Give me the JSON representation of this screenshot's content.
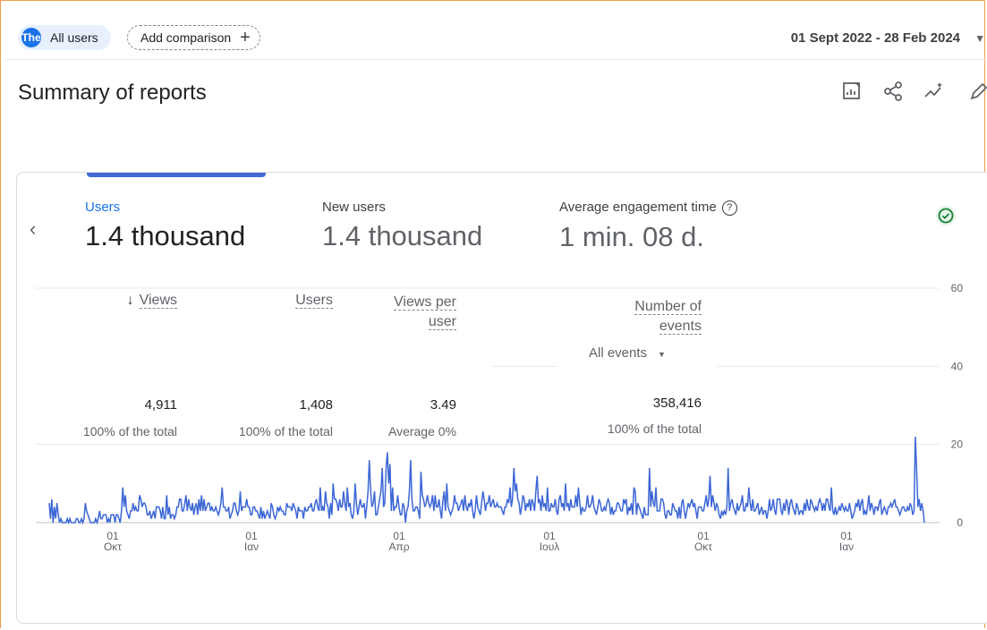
{
  "topbar": {
    "avatar": "The",
    "segment": "All users",
    "add_comparison": "Add comparison",
    "date_range": "01 Sept 2022 - 28 Feb 2024"
  },
  "page_title": "Summary of reports",
  "metrics": [
    {
      "label": "Users",
      "value": "1.4 thousand"
    },
    {
      "label": "New users",
      "value": "1.4 thousand"
    },
    {
      "label": "Average engagement time",
      "value": "1 min. 08 d."
    }
  ],
  "table": {
    "columns": [
      "Views",
      "Users",
      "Views per user",
      "Number of events"
    ],
    "values": [
      "4,911",
      "1,408",
      "3.49",
      "358,416"
    ],
    "subs": [
      "100% of the total",
      "100% of the total",
      "Average 0%",
      "100% of the total"
    ],
    "events_dropdown": "All events"
  },
  "chart_data": {
    "type": "line",
    "x_ticks": [
      {
        "day": "01",
        "month": "Οκτ"
      },
      {
        "day": "01",
        "month": "Ιαν"
      },
      {
        "day": "01",
        "month": "Απρ"
      },
      {
        "day": "01",
        "month": "Ιουλ"
      },
      {
        "day": "01",
        "month": "Οκτ"
      },
      {
        "day": "01",
        "month": "Ιαν"
      }
    ],
    "ylim": [
      0,
      60
    ],
    "y_ticks": [
      "60",
      "40",
      "20",
      "0"
    ],
    "series": [
      {
        "color": "#3c66d6",
        "values": [
          5,
          1,
          6,
          0,
          4,
          1,
          5,
          2,
          0,
          1,
          0,
          0,
          0,
          0,
          1,
          0,
          1,
          0,
          0,
          0,
          0,
          1,
          1,
          0,
          0,
          1,
          0,
          1,
          5,
          3,
          2,
          1,
          0,
          0,
          0,
          0,
          1,
          0,
          1,
          3,
          1,
          1,
          2,
          2,
          2,
          0,
          1,
          0,
          2,
          2,
          2,
          0,
          2,
          2,
          1,
          0,
          3,
          9,
          4,
          7,
          3,
          2,
          1,
          3,
          3,
          5,
          3,
          4,
          3,
          3,
          7,
          6,
          4,
          5,
          5,
          4,
          2,
          2,
          3,
          1,
          2,
          3,
          1,
          4,
          4,
          4,
          3,
          1,
          4,
          1,
          1,
          7,
          2,
          4,
          1,
          2,
          2,
          1,
          2,
          4,
          4,
          6,
          6,
          3,
          3,
          5,
          7,
          3,
          6,
          4,
          3,
          5,
          2,
          4,
          5,
          2,
          6,
          3,
          7,
          3,
          6,
          3,
          4,
          5,
          5,
          3,
          4,
          3,
          3,
          4,
          3,
          2,
          3,
          5,
          9,
          4,
          4,
          3,
          3,
          4,
          1,
          2,
          3,
          5,
          5,
          3,
          2,
          3,
          8,
          3,
          4,
          4,
          4,
          6,
          4,
          4,
          2,
          2,
          4,
          4,
          3,
          3,
          2,
          1,
          4,
          1,
          3,
          1,
          2,
          3,
          2,
          1,
          5,
          4,
          2,
          1,
          2,
          4,
          3,
          4,
          3,
          3,
          2,
          2,
          5,
          4,
          4,
          4,
          3,
          5,
          4,
          3,
          1,
          4,
          3,
          3,
          3,
          1,
          4,
          3,
          3,
          4,
          4,
          5,
          3,
          3,
          5,
          6,
          4,
          3,
          9,
          3,
          4,
          3,
          8,
          5,
          4,
          1,
          5,
          2,
          10,
          6,
          6,
          5,
          3,
          6,
          4,
          4,
          8,
          5,
          3,
          9,
          4,
          5,
          2,
          1,
          3,
          10,
          5,
          2,
          4,
          6,
          4,
          4,
          5,
          1,
          4,
          8,
          16,
          8,
          4,
          5,
          8,
          2,
          2,
          4,
          6,
          8,
          14,
          4,
          5,
          14,
          18,
          10,
          15,
          3,
          9,
          3,
          4,
          4,
          7,
          4,
          2,
          2,
          5,
          4,
          0,
          3,
          4,
          8,
          16,
          6,
          3,
          3,
          4,
          4,
          3,
          1,
          13,
          7,
          6,
          4,
          5,
          7,
          5,
          4,
          5,
          7,
          3,
          7,
          4,
          4,
          6,
          3,
          1,
          6,
          8,
          3,
          10,
          4,
          3,
          2,
          3,
          4,
          7,
          5,
          5,
          3,
          4,
          5,
          6,
          3,
          7,
          4,
          3,
          5,
          4,
          6,
          3,
          1,
          3,
          7,
          4,
          3,
          2,
          5,
          8,
          6,
          3,
          5,
          5,
          7,
          4,
          5,
          6,
          4,
          4,
          5,
          4,
          4,
          4,
          3,
          2,
          4,
          4,
          6,
          5,
          9,
          4,
          6,
          14,
          8,
          10,
          6,
          5,
          2,
          4,
          7,
          6,
          3,
          5,
          4,
          6,
          3,
          6,
          5,
          3,
          8,
          12,
          5,
          6,
          3,
          7,
          4,
          5,
          3,
          9,
          3,
          3,
          5,
          4,
          4,
          6,
          3,
          2,
          6,
          7,
          4,
          5,
          3,
          10,
          4,
          5,
          3,
          6,
          4,
          4,
          4,
          7,
          4,
          9,
          5,
          2,
          4,
          3,
          3,
          4,
          7,
          4,
          4,
          5,
          7,
          4,
          3,
          2,
          4,
          6,
          5,
          3,
          3,
          4,
          3,
          5,
          6,
          5,
          2,
          4,
          2,
          3,
          3,
          5,
          5,
          4,
          3,
          3,
          6,
          5,
          6,
          2,
          4,
          3,
          5,
          2,
          9,
          8,
          2,
          5,
          4,
          3,
          2,
          1,
          4,
          2,
          2,
          2,
          14,
          4,
          8,
          5,
          4,
          9,
          3,
          3,
          3,
          6,
          6,
          5,
          2,
          1,
          3,
          3,
          2,
          2,
          5,
          4,
          3,
          3,
          1,
          4,
          1,
          5,
          6,
          3,
          1,
          3,
          5,
          4,
          5,
          6,
          4,
          5,
          3,
          1,
          4,
          4,
          4,
          3,
          3,
          5,
          7,
          4,
          6,
          12,
          4,
          7,
          5,
          3,
          5,
          4,
          2,
          1,
          3,
          2,
          3,
          2,
          4,
          14,
          3,
          5,
          6,
          4,
          3,
          2,
          5,
          3,
          4,
          5,
          7,
          3,
          3,
          5,
          4,
          9,
          5,
          3,
          6,
          3,
          3,
          4,
          5,
          2,
          3,
          4,
          2,
          3,
          3,
          1,
          3,
          6,
          3,
          4,
          6,
          3,
          2,
          6,
          6,
          6,
          3,
          2,
          5,
          3,
          6,
          5,
          2,
          5,
          6,
          4,
          3,
          2,
          5,
          4,
          2,
          3,
          3,
          2,
          5,
          3,
          6,
          4,
          3,
          6,
          5,
          4,
          3,
          4,
          3,
          5,
          6,
          5,
          3,
          5,
          3,
          6,
          6,
          4,
          3,
          9,
          3,
          2,
          4,
          2,
          3,
          4,
          3,
          5,
          4,
          3,
          4,
          3,
          3,
          5,
          3,
          1,
          2,
          3,
          5,
          4,
          6,
          3,
          5,
          6,
          2,
          3,
          2,
          4,
          7,
          3,
          5,
          4,
          2,
          4,
          4,
          3,
          5,
          6,
          2,
          3,
          4,
          3,
          2,
          4,
          4,
          5,
          4,
          5,
          6,
          4,
          4,
          3,
          2,
          3,
          4,
          4,
          3,
          3,
          4,
          3,
          5,
          4,
          2,
          3,
          22,
          14,
          4,
          6,
          3,
          5,
          3,
          0
        ]
      }
    ]
  }
}
